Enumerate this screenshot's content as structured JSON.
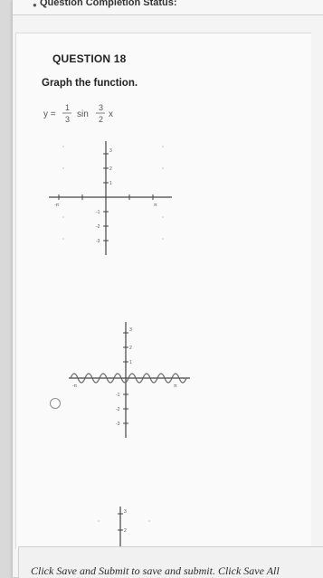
{
  "status": {
    "label": "Question Completion Status:"
  },
  "question": {
    "title": "QUESTION 18",
    "prompt": "Graph the function.",
    "equation": {
      "lhs": "y =",
      "coef_num": "1",
      "coef_den": "3",
      "func": "sin",
      "arg_num": "3",
      "arg_den": "2",
      "var": "x"
    }
  },
  "graphs": {
    "g1": {
      "y_ticks": [
        "3",
        "2",
        "1",
        "-1",
        "-2",
        "-3"
      ],
      "x_ticks": [
        "-π",
        "π"
      ]
    },
    "g2": {
      "y_ticks": [
        "3",
        "2",
        "1",
        "-1",
        "-2",
        "-3"
      ],
      "x_ticks": [
        "-π",
        "π"
      ]
    },
    "g3": {
      "y_ticks": [
        "3",
        "2"
      ]
    }
  },
  "footer": {
    "text": "Click Save and Submit to save and submit. Click Save All"
  }
}
